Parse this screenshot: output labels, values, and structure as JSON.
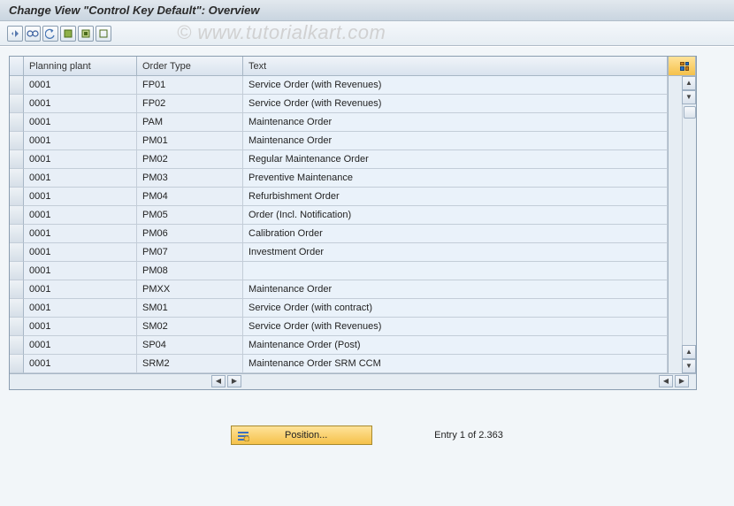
{
  "title": "Change View \"Control Key Default\": Overview",
  "watermark": "© www.tutorialkart.com",
  "toolbar_icons": [
    "other-view-icon",
    "glasses-icon",
    "undo-icon",
    "select-all-icon",
    "select-block-icon",
    "deselect-all-icon"
  ],
  "table": {
    "headers": {
      "planning_plant": "Planning plant",
      "order_type": "Order Type",
      "text": "Text"
    },
    "rows": [
      {
        "plant": "0001",
        "otype": "FP01",
        "text": "Service Order (with Revenues)"
      },
      {
        "plant": "0001",
        "otype": "FP02",
        "text": "Service Order (with Revenues)"
      },
      {
        "plant": "0001",
        "otype": "PAM",
        "text": "Maintenance Order"
      },
      {
        "plant": "0001",
        "otype": "PM01",
        "text": "Maintenance Order"
      },
      {
        "plant": "0001",
        "otype": "PM02",
        "text": "Regular Maintenance Order"
      },
      {
        "plant": "0001",
        "otype": "PM03",
        "text": "Preventive Maintenance"
      },
      {
        "plant": "0001",
        "otype": "PM04",
        "text": "Refurbishment Order"
      },
      {
        "plant": "0001",
        "otype": "PM05",
        "text": "Order (Incl. Notification)"
      },
      {
        "plant": "0001",
        "otype": "PM06",
        "text": "Calibration Order"
      },
      {
        "plant": "0001",
        "otype": "PM07",
        "text": "Investment Order"
      },
      {
        "plant": "0001",
        "otype": "PM08",
        "text": ""
      },
      {
        "plant": "0001",
        "otype": "PMXX",
        "text": "Maintenance Order"
      },
      {
        "plant": "0001",
        "otype": "SM01",
        "text": "Service Order (with contract)"
      },
      {
        "plant": "0001",
        "otype": "SM02",
        "text": "Service Order (with Revenues)"
      },
      {
        "plant": "0001",
        "otype": "SP04",
        "text": "Maintenance Order (Post)"
      },
      {
        "plant": "0001",
        "otype": "SRM2",
        "text": "Maintenance Order SRM CCM"
      }
    ]
  },
  "footer": {
    "position_button_label": "Position...",
    "entry_text": "Entry 1 of 2.363"
  }
}
